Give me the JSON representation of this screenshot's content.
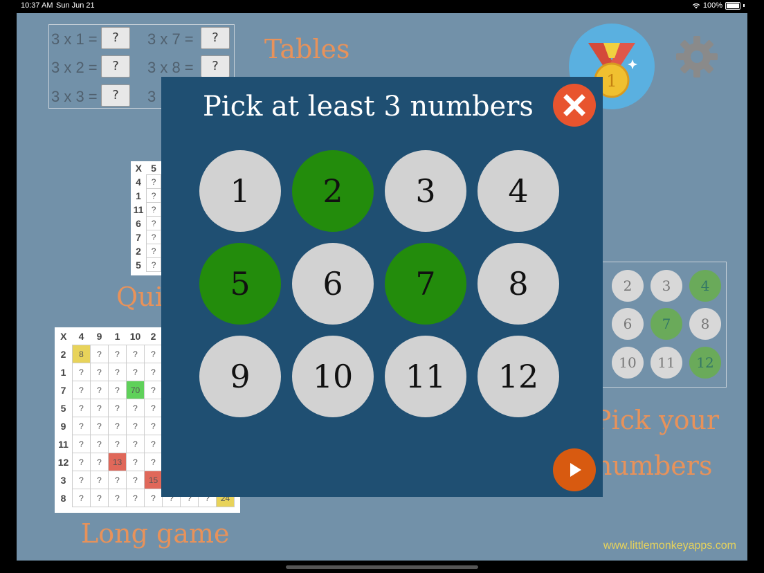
{
  "status_bar": {
    "time": "10:37 AM",
    "date": "Sun Jun 21",
    "battery": "100%"
  },
  "background": {
    "tables": {
      "label": "Tables",
      "rows": [
        {
          "expr": "3 x 1 =",
          "answer": "?"
        },
        {
          "expr": "3 x 2 =",
          "answer": "?"
        },
        {
          "expr": "3 x 3 =",
          "answer": "?"
        },
        {
          "expr": "3 x 7 =",
          "answer": "?"
        },
        {
          "expr": "3 x 8 =",
          "answer": "?"
        },
        {
          "expr": "3",
          "answer": ""
        }
      ]
    },
    "quiz": {
      "label": "Qui",
      "header": [
        "X",
        "5"
      ],
      "rows": [
        "4",
        "1",
        "11",
        "6",
        "7",
        "2",
        "5"
      ],
      "cell": "?"
    },
    "long_game": {
      "label": "Long game",
      "header": [
        "X",
        "4",
        "9",
        "1",
        "10",
        "2"
      ],
      "rows": [
        [
          "2",
          "8",
          "?",
          "?",
          "?",
          "?"
        ],
        [
          "1",
          "?",
          "?",
          "?",
          "?",
          "?"
        ],
        [
          "7",
          "?",
          "?",
          "?",
          "70",
          "?"
        ],
        [
          "5",
          "?",
          "?",
          "?",
          "?",
          "?"
        ],
        [
          "9",
          "?",
          "?",
          "?",
          "?",
          "?"
        ],
        [
          "11",
          "?",
          "?",
          "?",
          "?",
          "?"
        ],
        [
          "12",
          "?",
          "?",
          "13",
          "?",
          "?"
        ],
        [
          "3",
          "?",
          "?",
          "?",
          "?",
          "15"
        ],
        [
          "8",
          "?",
          "?",
          "?",
          "?",
          "?",
          "?",
          "?",
          "?",
          "24"
        ]
      ]
    },
    "pick_numbers": {
      "label_line1": "Pick your",
      "label_line2": "numbers",
      "mini": [
        {
          "n": "2",
          "sel": false
        },
        {
          "n": "3",
          "sel": false
        },
        {
          "n": "4",
          "sel": true
        },
        {
          "n": "6",
          "sel": false
        },
        {
          "n": "7",
          "sel": true
        },
        {
          "n": "8",
          "sel": false
        },
        {
          "n": "10",
          "sel": false
        },
        {
          "n": "11",
          "sel": false
        },
        {
          "n": "12",
          "sel": true
        }
      ]
    },
    "website": "www.littlemonkeyapps.com",
    "medal_number": "1"
  },
  "modal": {
    "title": "Pick at least 3 numbers",
    "numbers": [
      {
        "label": "1",
        "selected": false
      },
      {
        "label": "2",
        "selected": true
      },
      {
        "label": "3",
        "selected": false
      },
      {
        "label": "4",
        "selected": false
      },
      {
        "label": "5",
        "selected": true
      },
      {
        "label": "6",
        "selected": false
      },
      {
        "label": "7",
        "selected": true
      },
      {
        "label": "8",
        "selected": false
      },
      {
        "label": "9",
        "selected": false
      },
      {
        "label": "10",
        "selected": false
      },
      {
        "label": "11",
        "selected": false
      },
      {
        "label": "12",
        "selected": false
      }
    ],
    "close_icon": "close-icon",
    "play_icon": "play-icon"
  },
  "colors": {
    "screen_bg": "#7291a9",
    "modal_bg": "#1f4f72",
    "selected_green": "#238c0c",
    "unselected_gray": "#d2d2d2",
    "close_red": "#e8542e",
    "play_orange": "#d85a10",
    "label_orange": "#e8925a"
  }
}
